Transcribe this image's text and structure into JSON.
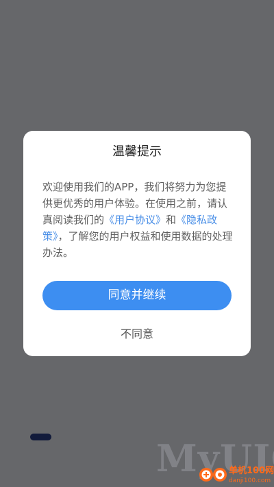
{
  "dialog": {
    "title": "温馨提示",
    "body_before": "欢迎使用我们的APP，我们将努力为您提供更优秀的用户体验。在使用之前，请认真阅读我们的",
    "user_agreement_link": "《用户协议》",
    "connector": "和",
    "privacy_policy_link": "《隐私政策》",
    "body_after": "，了解您的用户权益和使用数据的处理办法。",
    "agree_label": "同意并继续",
    "disagree_label": "不同意"
  },
  "watermark": {
    "bg_text": "MyUICC",
    "site_name": "单机100网",
    "site_url": "danji100.com"
  },
  "colors": {
    "accent": "#3d8ef1",
    "link": "#4a8fe7",
    "overlay": "rgba(0,0,0,0.56)",
    "watermark": "#ff6a1a"
  }
}
